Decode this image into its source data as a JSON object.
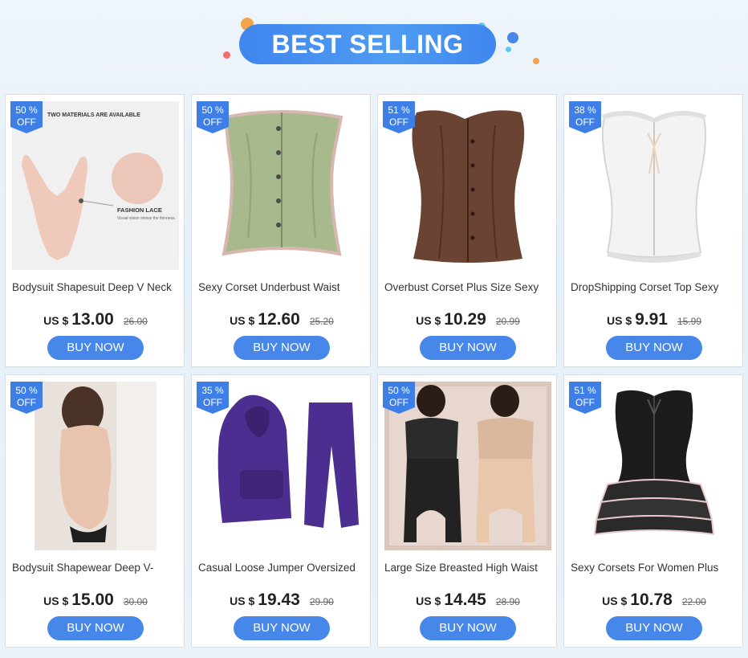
{
  "banner": {
    "title": "BEST SELLING"
  },
  "colors": {
    "accent": "#4787ea",
    "badge": "#3d7fe6"
  },
  "products": [
    {
      "title": "Bodysuit Shapesuit Deep V Neck",
      "currency": "US $",
      "price": "13.00",
      "old_price": "26.00",
      "discount_pct": "50 %",
      "discount_off": "OFF",
      "button": "BUY NOW",
      "image_text": {
        "caption": "TWO MATERIALS ARE AVAILABLE",
        "label": "FASHION LACE",
        "sub": "Visual vision shows the thinness."
      }
    },
    {
      "title": "Sexy Corset Underbust Waist",
      "currency": "US $",
      "price": "12.60",
      "old_price": "25.20",
      "discount_pct": "50 %",
      "discount_off": "OFF",
      "button": "BUY NOW"
    },
    {
      "title": "Overbust Corset Plus Size Sexy",
      "currency": "US $",
      "price": "10.29",
      "old_price": "20.99",
      "discount_pct": "51 %",
      "discount_off": "OFF",
      "button": "BUY NOW"
    },
    {
      "title": "DropShipping Corset Top Sexy",
      "currency": "US $",
      "price": "9.91",
      "old_price": "15.99",
      "discount_pct": "38 %",
      "discount_off": "OFF",
      "button": "BUY NOW"
    },
    {
      "title": "Bodysuit Shapewear Deep V-",
      "currency": "US $",
      "price": "15.00",
      "old_price": "30.00",
      "discount_pct": "50 %",
      "discount_off": "OFF",
      "button": "BUY NOW"
    },
    {
      "title": "Casual Loose Jumper Oversized",
      "currency": "US $",
      "price": "19.43",
      "old_price": "29.90",
      "discount_pct": "35 %",
      "discount_off": "OFF",
      "button": "BUY NOW"
    },
    {
      "title": "Large Size Breasted High Waist",
      "currency": "US $",
      "price": "14.45",
      "old_price": "28.90",
      "discount_pct": "50 %",
      "discount_off": "OFF",
      "button": "BUY NOW"
    },
    {
      "title": "Sexy Corsets For Women Plus",
      "currency": "US $",
      "price": "10.78",
      "old_price": "22.00",
      "discount_pct": "51 %",
      "discount_off": "OFF",
      "button": "BUY NOW"
    }
  ]
}
